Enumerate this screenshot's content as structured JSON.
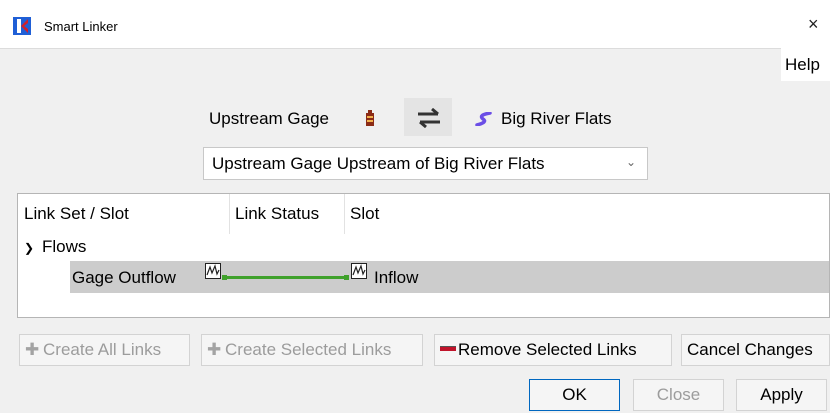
{
  "window": {
    "title": "Smart Linker",
    "close_glyph": "×"
  },
  "menu": {
    "help": "Help"
  },
  "objects": {
    "upstream": "Upstream Gage",
    "upstream_icon": "stream-gage-icon",
    "swap_icon": "swap-arrows-icon",
    "downstream": "Big River Flats",
    "downstream_icon": "reach-icon"
  },
  "link_set_select": {
    "value": "Upstream Gage Upstream of Big River Flats"
  },
  "tree": {
    "headers": [
      "Link Set / Slot",
      "Link Status",
      "Slot"
    ],
    "group": "Flows",
    "rows": [
      {
        "source_slot": "Gage Outflow",
        "target_slot": "Inflow",
        "status": "linked"
      }
    ]
  },
  "buttons": {
    "create_all": "Create All Links",
    "create_selected": "Create Selected Links",
    "remove_selected": "Remove Selected Links",
    "cancel_changes": "Cancel Changes",
    "ok": "OK",
    "close": "Close",
    "apply": "Apply"
  },
  "colors": {
    "link_line": "#3fa12b",
    "remove_mark": "#c0142b",
    "reach_icon": "#6b4ee6",
    "app_icon_blue": "#1f5fd6",
    "app_icon_red": "#d11f2a"
  }
}
